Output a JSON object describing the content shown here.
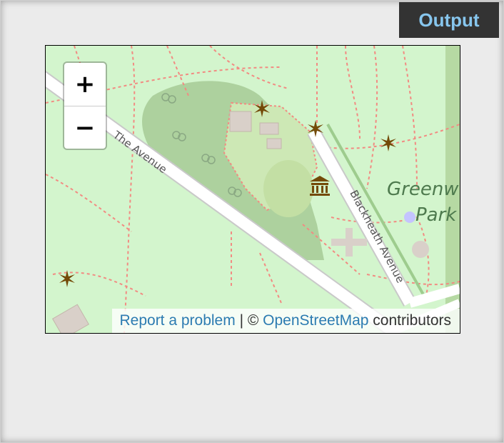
{
  "output_badge": "Output",
  "map": {
    "zoom_in_label": "+",
    "zoom_out_label": "−",
    "road_labels": {
      "the_avenue": "The Avenue",
      "blackheath_avenue": "Blackheath Avenue"
    },
    "area_label": {
      "line1": "Greenw",
      "line2": "Park"
    },
    "attribution": {
      "report_link": "Report a problem",
      "separator": " | © ",
      "osm_link": "OpenStreetMap",
      "suffix": " contributors"
    },
    "colors": {
      "park_background": "#d3f5cd",
      "wooded_area": "#add19e",
      "road": "#ffffff",
      "footpath": "#f28b82",
      "attraction_icon": "#734a08",
      "link": "#2c7bb1"
    }
  }
}
